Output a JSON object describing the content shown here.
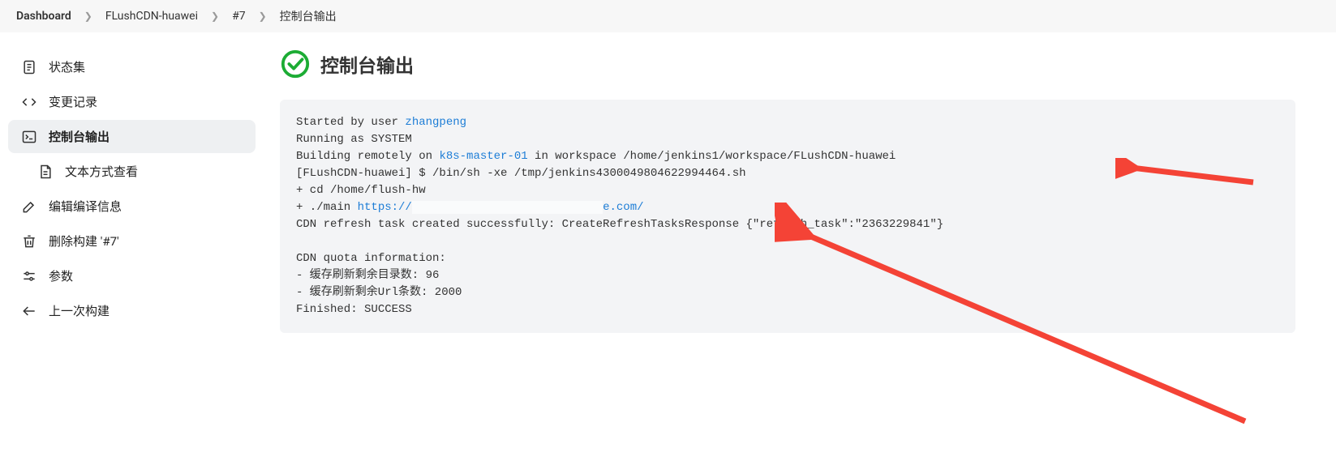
{
  "breadcrumbs": [
    {
      "label": "Dashboard"
    },
    {
      "label": "FLushCDN-huawei"
    },
    {
      "label": "#7"
    },
    {
      "label": "控制台输出"
    }
  ],
  "sidebar": {
    "items": [
      {
        "label": "状态集"
      },
      {
        "label": "变更记录"
      },
      {
        "label": "控制台输出"
      },
      {
        "label": "文本方式查看"
      },
      {
        "label": "编辑编译信息"
      },
      {
        "label": "删除构建 '#7'"
      },
      {
        "label": "参数"
      },
      {
        "label": "上一次构建"
      }
    ]
  },
  "header": {
    "title": "控制台输出"
  },
  "console": {
    "started_by_prefix": "Started by user ",
    "user_link": "zhangpeng",
    "running_as": "Running as SYSTEM",
    "building_prefix": "Building remotely on ",
    "node_link": "k8s-master-01",
    "building_suffix": " in workspace /home/jenkins1/workspace/FLushCDN-huawei",
    "sh_line": "[FLushCDN-huawei] $ /bin/sh -xe /tmp/jenkins4300049804622994464.sh",
    "cd_line": "+ cd /home/flush-hw",
    "main_prefix": "+ ./main ",
    "url_scheme": "https://",
    "url_redacted": "                            ",
    "url_tail": "e.com/",
    "refresh_line": "CDN refresh task created successfully: CreateRefreshTasksResponse {\"refresh_task\":\"2363229841\"}",
    "quota_header": "CDN quota information:",
    "quota_dirs": "- 缓存刷新剩余目录数: 96",
    "quota_urls": "- 缓存刷新剩余Url条数: 2000",
    "finished": "Finished: SUCCESS"
  }
}
